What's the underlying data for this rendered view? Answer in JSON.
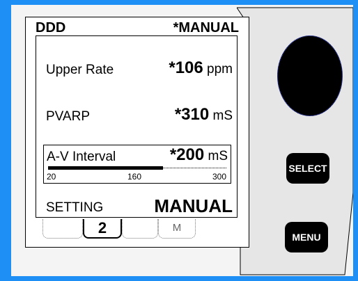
{
  "header": {
    "mode": "DDD",
    "setting": "*MANUAL"
  },
  "params": [
    {
      "label": "Upper Rate",
      "value": "*106",
      "unit": "ppm"
    },
    {
      "label": "PVARP",
      "value": "*310",
      "unit": "mS"
    }
  ],
  "av_interval": {
    "label": "A-V Interval",
    "value": "*200",
    "unit": "mS",
    "slider_min": "20",
    "slider_mid": "160",
    "slider_max": "300",
    "level": 200
  },
  "setting": {
    "label": "SETTING",
    "value": "MANUAL"
  },
  "tabs": [
    {
      "label": ""
    },
    {
      "label": "2"
    },
    {
      "label": "M"
    }
  ],
  "buttons": {
    "select": "SELECT",
    "menu": "MENU"
  },
  "colors": {
    "frame": "#1e8ff5",
    "panel": "#e6e6e6",
    "knob": "#000000"
  }
}
